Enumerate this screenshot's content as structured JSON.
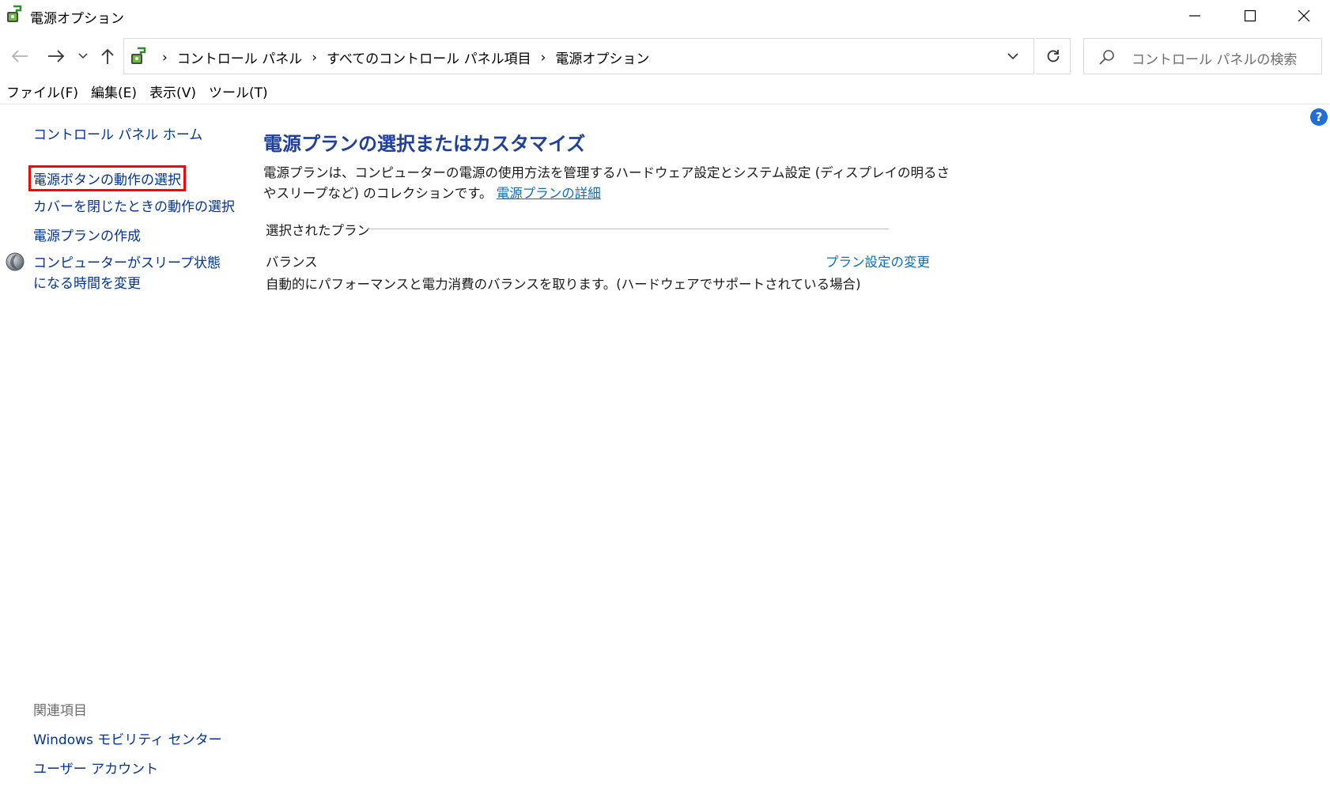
{
  "window": {
    "title": "電源オプション"
  },
  "address": {
    "crumbs": [
      "コントロール パネル",
      "すべてのコントロール パネル項目",
      "電源オプション"
    ]
  },
  "search": {
    "placeholder": "コントロール パネルの検索"
  },
  "menu": {
    "items": [
      "ファイル(F)",
      "編集(E)",
      "表示(V)",
      "ツール(T)"
    ]
  },
  "left_pane": {
    "home": "コントロール パネル ホーム",
    "power_button": "電源ボタンの動作の選択",
    "lid": "カバーを閉じたときの動作の選択",
    "create_plan": "電源プランの作成",
    "sleep_time": "コンピューターがスリープ状態になる時間を変更",
    "related_heading": "関連項目",
    "mobility_center": "Windows モビリティ センター",
    "user_accounts": "ユーザー アカウント"
  },
  "main": {
    "title": "電源プランの選択またはカスタマイズ",
    "description": "電源プランは、コンピューターの電源の使用方法を管理するハードウェア設定とシステム設定 (ディスプレイの明るさやスリープなど) のコレクションです。",
    "details_link": "電源プランの詳細",
    "selected_plan_heading": "選択されたプラン",
    "plan_name": "バランス",
    "plan_change_link": "プラン設定の変更",
    "plan_description": "自動的にパフォーマンスと電力消費のバランスを取ります。(ハードウェアでサポートされている場合)"
  },
  "colors": {
    "link": "#003399",
    "title": "#1e3f9e",
    "highlight_border": "#ee0a0a",
    "help": "#1f6fd6"
  }
}
